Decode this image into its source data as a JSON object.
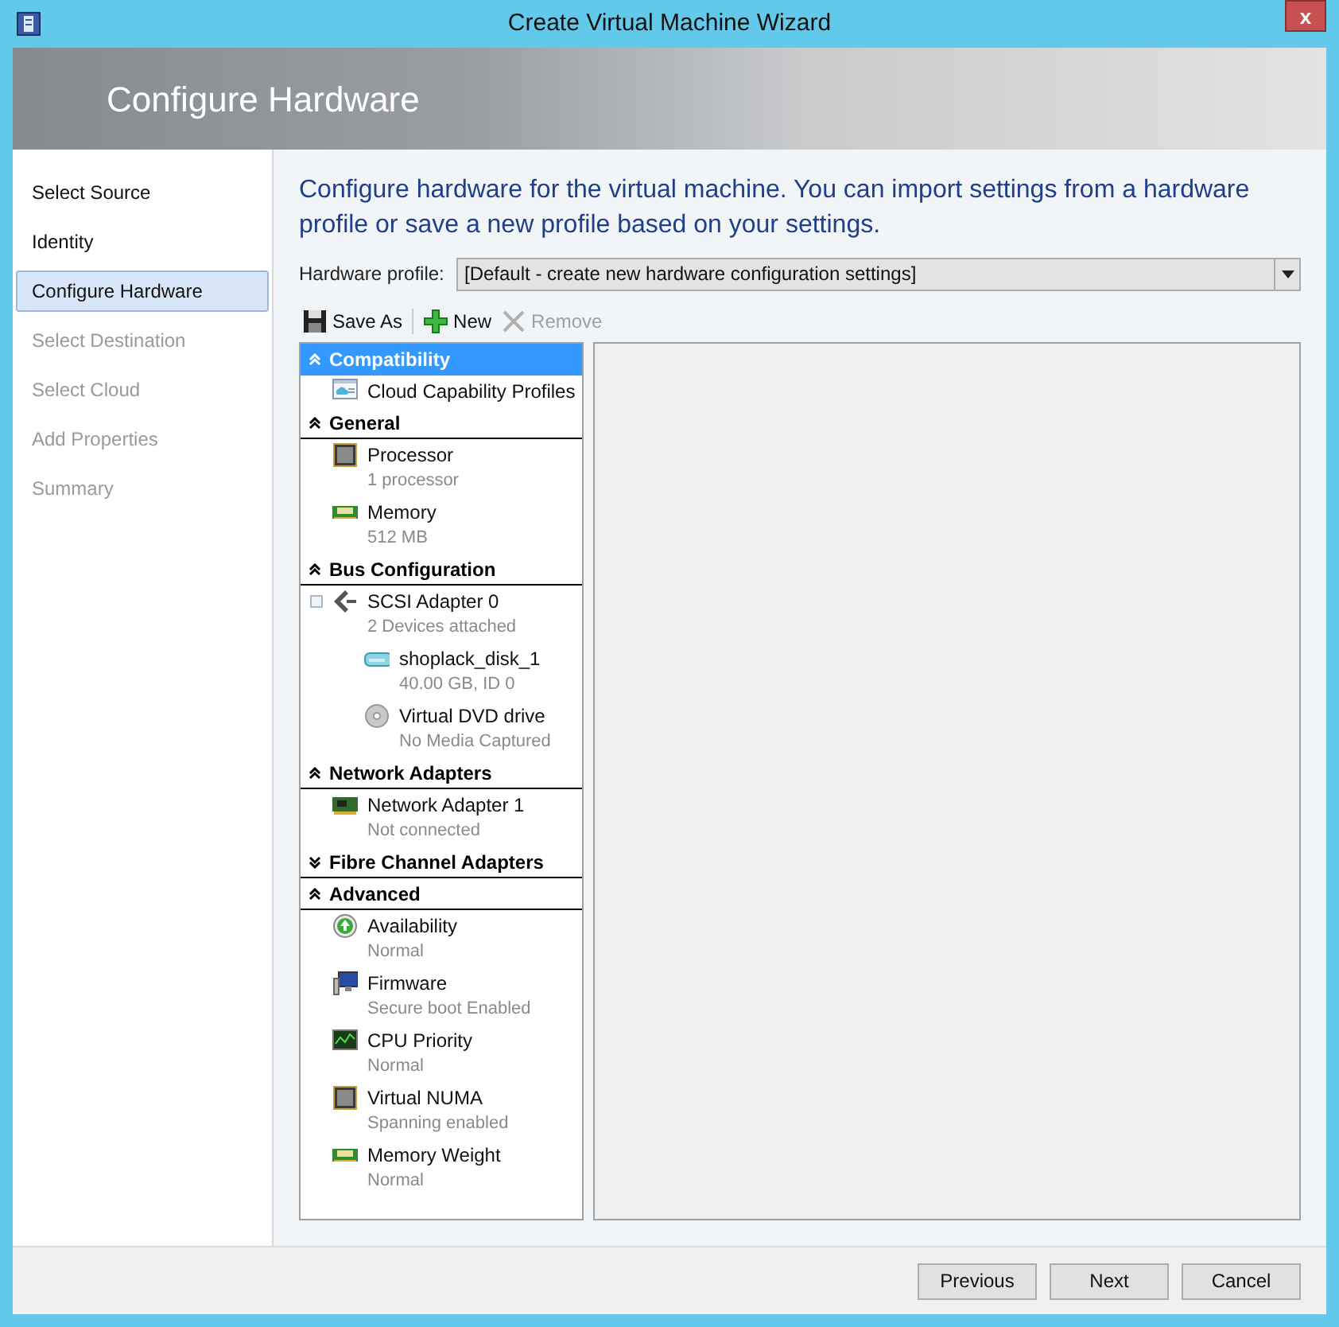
{
  "window": {
    "title": "Create Virtual Machine Wizard",
    "close": "x"
  },
  "header": {
    "title": "Configure Hardware"
  },
  "steps": [
    {
      "label": "Select Source",
      "selected": false,
      "disabled": false
    },
    {
      "label": "Identity",
      "selected": false,
      "disabled": false
    },
    {
      "label": "Configure Hardware",
      "selected": true,
      "disabled": false
    },
    {
      "label": "Select Destination",
      "selected": false,
      "disabled": true
    },
    {
      "label": "Select Cloud",
      "selected": false,
      "disabled": true
    },
    {
      "label": "Add Properties",
      "selected": false,
      "disabled": true
    },
    {
      "label": "Summary",
      "selected": false,
      "disabled": true
    }
  ],
  "instructions": "Configure hardware for the virtual machine. You can import settings from a hardware profile or save a new profile based on your settings.",
  "hardware_profile": {
    "label": "Hardware profile:",
    "value": "[Default - create new hardware configuration settings]"
  },
  "toolbar": [
    {
      "kind": "save",
      "label": "Save As",
      "disabled": false
    },
    {
      "kind": "new",
      "label": "New",
      "disabled": false
    },
    {
      "kind": "remove",
      "label": "Remove",
      "disabled": true
    }
  ],
  "sections": [
    {
      "title": "Compatibility",
      "expanded": true,
      "selected": true,
      "items": [
        {
          "kind": "cloud",
          "name": "Cloud Capability Profiles"
        }
      ]
    },
    {
      "title": "General",
      "expanded": true,
      "selected": false,
      "items": [
        {
          "kind": "cpu",
          "name": "Processor",
          "detail": "1 processor"
        },
        {
          "kind": "memory",
          "name": "Memory",
          "detail": "512 MB"
        }
      ]
    },
    {
      "title": "Bus Configuration",
      "expanded": true,
      "selected": false,
      "items": [
        {
          "kind": "scsi",
          "name": "SCSI Adapter 0",
          "detail": "2 Devices attached",
          "expanded": true,
          "children": [
            {
              "kind": "disk",
              "name": "shoplack_disk_1",
              "detail": "40.00 GB, ID 0"
            },
            {
              "kind": "dvd",
              "name": "Virtual DVD drive",
              "detail": "No Media Captured"
            }
          ]
        }
      ]
    },
    {
      "title": "Network Adapters",
      "expanded": true,
      "selected": false,
      "items": [
        {
          "kind": "nic",
          "name": "Network Adapter 1",
          "detail": "Not connected"
        }
      ]
    },
    {
      "title": "Fibre Channel Adapters",
      "expanded": false,
      "selected": false
    },
    {
      "title": "Advanced",
      "expanded": true,
      "selected": false,
      "items": [
        {
          "kind": "availability",
          "name": "Availability",
          "detail": "Normal"
        },
        {
          "kind": "firmware",
          "name": "Firmware",
          "detail": "Secure boot Enabled"
        },
        {
          "kind": "cpu-priority",
          "name": "CPU Priority",
          "detail": "Normal"
        },
        {
          "kind": "cpu",
          "name": "Virtual NUMA",
          "detail": "Spanning enabled"
        },
        {
          "kind": "memory",
          "name": "Memory Weight",
          "detail": "Normal"
        }
      ]
    }
  ],
  "buttons": [
    "Previous",
    "Next",
    "Cancel"
  ]
}
